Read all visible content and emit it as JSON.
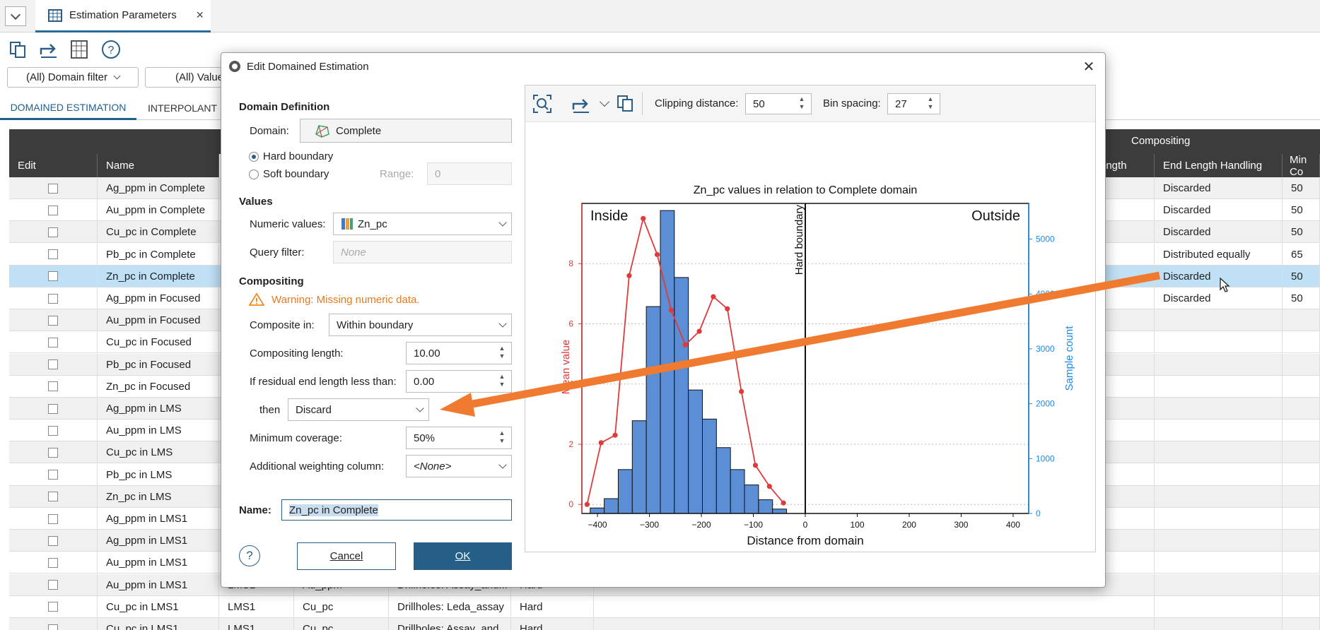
{
  "tab": {
    "title": "Estimation Parameters"
  },
  "filters": {
    "domain": "(All) Domain filter",
    "values": "(All) Value"
  },
  "subtabs": [
    "DOMAINED ESTIMATION",
    "INTERPOLANT"
  ],
  "table": {
    "group_header": "Compositing",
    "headers": {
      "edit": "Edit",
      "name": "Name",
      "ength": "ength",
      "end_length": "End Length Handling",
      "min_co": "Min Co"
    },
    "rows": [
      {
        "name": "Ag_ppm in Complete",
        "end": "Discarded",
        "min": "50"
      },
      {
        "name": "Au_ppm in Complete",
        "end": "Discarded",
        "min": "50"
      },
      {
        "name": "Cu_pc in Complete",
        "end": "Discarded",
        "min": "50"
      },
      {
        "name": "Pb_pc in Complete",
        "end": "Distributed equally",
        "min": "65"
      },
      {
        "name": "Zn_pc in Complete",
        "end": "Discarded",
        "min": "50"
      },
      {
        "name": "Ag_ppm in Focused",
        "end": "Discarded",
        "min": "50"
      },
      {
        "name": "Au_ppm in Focused",
        "end": "",
        "min": ""
      },
      {
        "name": "Cu_pc in Focused",
        "end": "",
        "min": ""
      },
      {
        "name": "Pb_pc in Focused",
        "end": "",
        "min": ""
      },
      {
        "name": "Zn_pc in Focused",
        "end": "",
        "min": ""
      },
      {
        "name": "Ag_ppm in LMS",
        "end": "",
        "min": ""
      },
      {
        "name": "Au_ppm in LMS",
        "end": "",
        "min": ""
      },
      {
        "name": "Cu_pc in LMS",
        "end": "",
        "min": ""
      },
      {
        "name": "Pb_pc in LMS",
        "end": "",
        "min": ""
      },
      {
        "name": "Zn_pc in LMS",
        "end": "",
        "min": ""
      },
      {
        "name": "Ag_ppm in LMS1",
        "end": "",
        "min": ""
      },
      {
        "name": "Ag_ppm in LMS1",
        "end": "",
        "min": ""
      },
      {
        "name": "Au_ppm in LMS1",
        "end": "",
        "min": ""
      },
      {
        "name": "Au_ppm in LMS1",
        "domain": "LMS1",
        "value": "Au_ppm",
        "src": "Drillholes: Assay_and...",
        "bnd": "Hard",
        "end": "",
        "min": ""
      },
      {
        "name": "Cu_pc in LMS1",
        "domain": "LMS1",
        "value": "Cu_pc",
        "src": "Drillholes: Leda_assay",
        "bnd": "Hard",
        "end": "",
        "min": ""
      },
      {
        "name": "Cu_pc in LMS1",
        "domain": "LMS1",
        "value": "Cu_pc",
        "src": "Drillholes: Assay_and...",
        "bnd": "Hard",
        "end": "",
        "min": ""
      }
    ]
  },
  "dialog": {
    "title": "Edit Domained Estimation",
    "domain_definition": "Domain Definition",
    "domain_label": "Domain:",
    "domain_value": "Complete",
    "hard_boundary": "Hard boundary",
    "soft_boundary": "Soft boundary",
    "range_label": "Range:",
    "range_value": "0",
    "values_section": "Values",
    "numeric_label": "Numeric values:",
    "numeric_value": "Zn_pc",
    "query_label": "Query filter:",
    "query_placeholder": "None",
    "compositing_section": "Compositing",
    "warning": "Warning: Missing numeric data.",
    "composite_in_label": "Composite in:",
    "composite_in_value": "Within boundary",
    "comp_length_label": "Compositing length:",
    "comp_length_value": "10.00",
    "residual_label": "If residual end length less than:",
    "residual_value": "0.00",
    "then_label": "then",
    "then_value": "Discard",
    "min_cov_label": "Minimum coverage:",
    "min_cov_value": "50%",
    "weight_label": "Additional weighting column:",
    "weight_value": "<None>",
    "name_label": "Name:",
    "name_value": "Zn_pc in Complete",
    "help_icon": "?",
    "cancel": "Cancel",
    "ok": "OK",
    "clipping_label": "Clipping distance:",
    "clipping_value": "50",
    "bin_label": "Bin spacing:",
    "bin_value": "27"
  },
  "chart_data": {
    "type": "bar",
    "title": "Zn_pc values in relation to Complete domain",
    "xlabel": "Distance from domain",
    "ylabel_left": "Mean value",
    "ylabel_right": "Sample count",
    "inside_label": "Inside",
    "outside_label": "Outside",
    "boundary_label": "Hard boundary",
    "xlim": [
      -430,
      430
    ],
    "ylim_left": [
      -0.3,
      10
    ],
    "ylim_right": [
      0,
      5650
    ],
    "xticks": [
      -400,
      -300,
      -200,
      -100,
      0,
      100,
      200,
      300,
      400
    ],
    "yticks_left": [
      0,
      2,
      4,
      6,
      8
    ],
    "yticks_right": [
      0,
      1000,
      2000,
      3000,
      4000,
      5000
    ],
    "bin_width": 27,
    "histogram": {
      "bin_starts": [
        -414,
        -387,
        -360,
        -333,
        -306,
        -279,
        -252,
        -225,
        -198,
        -171,
        -144,
        -117,
        -90,
        -63
      ],
      "counts": [
        100,
        270,
        800,
        1690,
        3770,
        5520,
        4300,
        2250,
        1720,
        1200,
        800,
        520,
        250,
        80
      ]
    },
    "mean_line": {
      "x": [
        -420,
        -393,
        -366,
        -339,
        -312,
        -285,
        -258,
        -231,
        -204,
        -177,
        -150,
        -123,
        -96,
        -69,
        -42
      ],
      "y": [
        0,
        2.05,
        2.3,
        7.6,
        9.5,
        8.3,
        6.45,
        5.3,
        5.75,
        6.9,
        6.5,
        3.75,
        1.3,
        0.6,
        0.05
      ]
    },
    "colors": {
      "bars": "#5b8ed4",
      "line": "#e03a3a",
      "left_axis": "#e03a3a",
      "right_axis": "#1e88e5",
      "arrow": "#f07a30"
    }
  }
}
